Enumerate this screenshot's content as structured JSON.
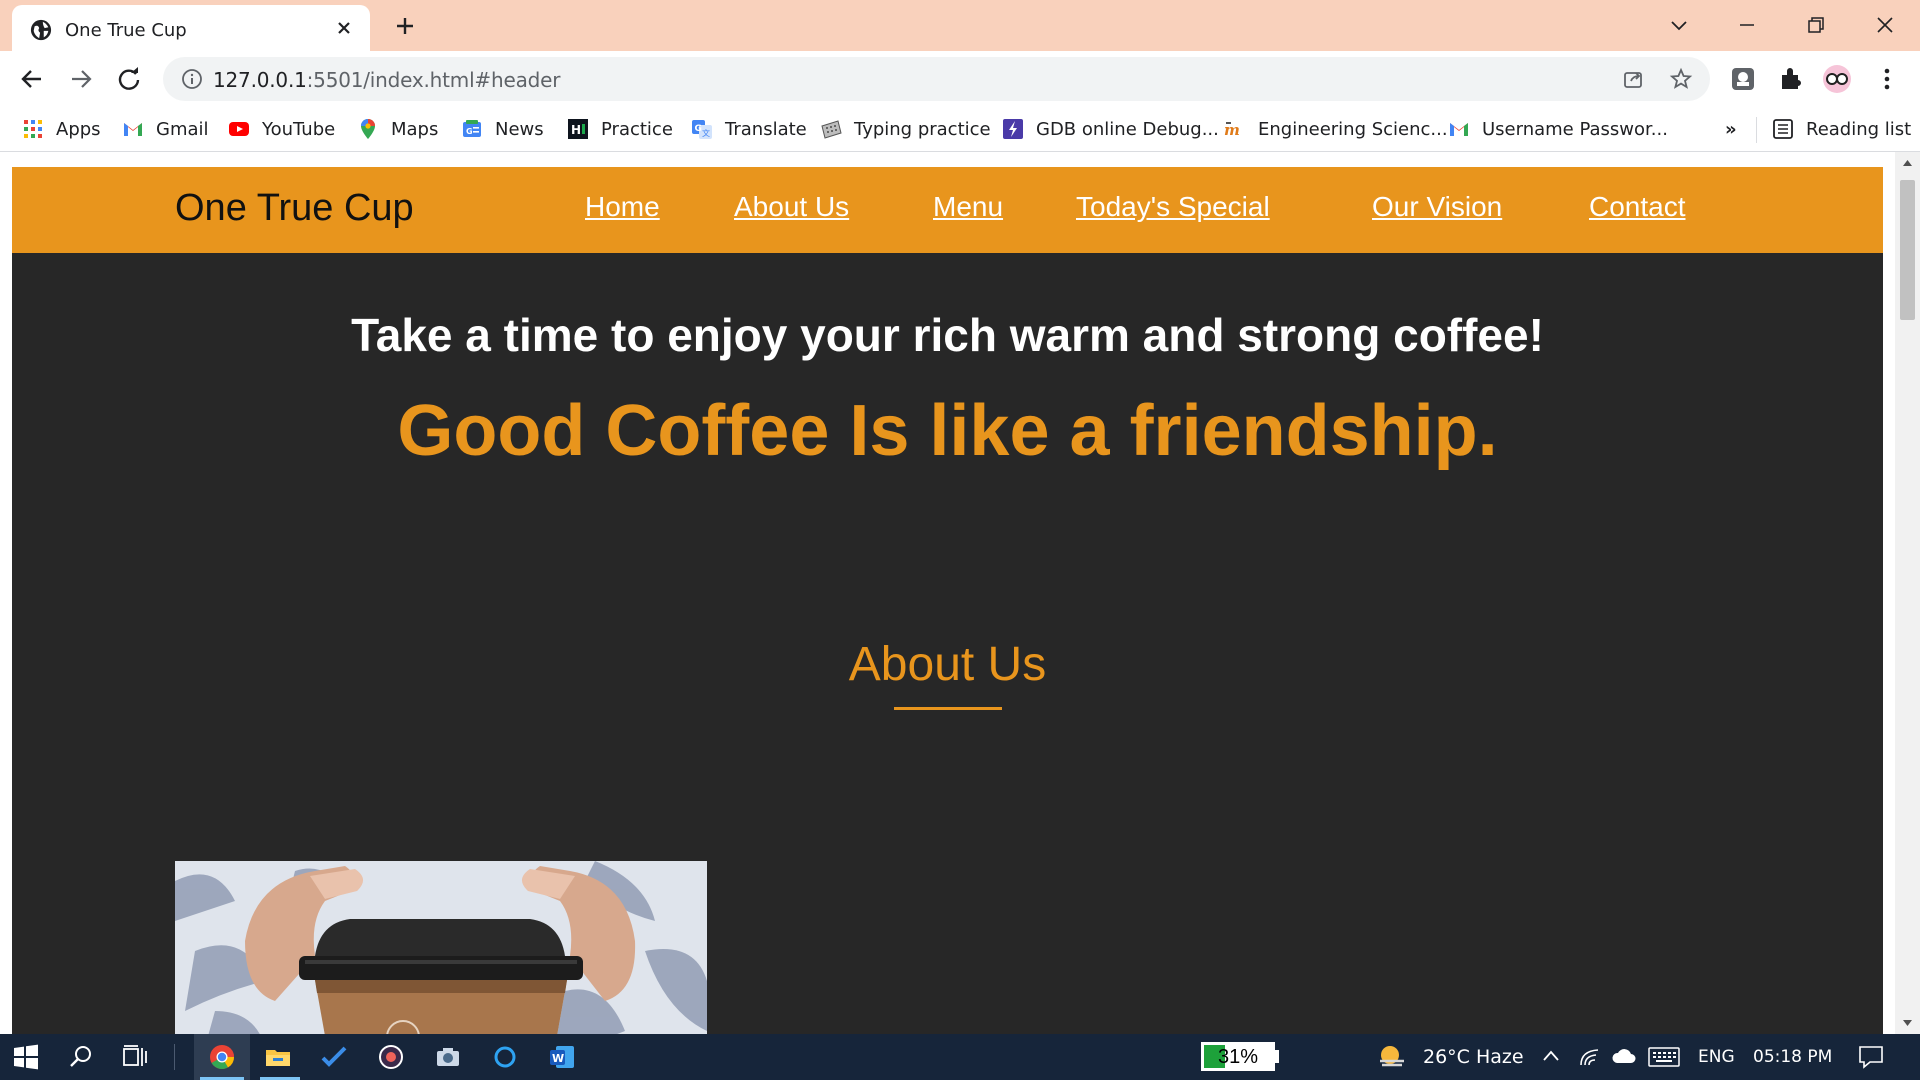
{
  "browser": {
    "tab_title": "One True Cup",
    "url_host": "127.0.0.1",
    "url_rest": ":5501/index.html#header",
    "bookmarks": [
      {
        "label": "Apps",
        "icon": "apps-grid-icon"
      },
      {
        "label": "Gmail",
        "icon": "gmail-icon"
      },
      {
        "label": "YouTube",
        "icon": "youtube-icon"
      },
      {
        "label": "Maps",
        "icon": "maps-pin-icon"
      },
      {
        "label": "News",
        "icon": "news-icon"
      },
      {
        "label": "Practice",
        "icon": "hackerrank-icon"
      },
      {
        "label": "Translate",
        "icon": "translate-icon"
      },
      {
        "label": "Typing practice",
        "icon": "typing-icon"
      },
      {
        "label": "GDB online Debug...",
        "icon": "gdb-icon"
      },
      {
        "label": "Engineering Scienc...",
        "icon": "engineering-icon"
      },
      {
        "label": "Username Passwor...",
        "icon": "gmail-icon"
      }
    ],
    "overflow_label": "»",
    "reading_list_label": "Reading list"
  },
  "site": {
    "brand": "One True Cup",
    "nav": [
      {
        "label": "Home"
      },
      {
        "label": "About Us"
      },
      {
        "label": "Menu"
      },
      {
        "label": "Today's Special"
      },
      {
        "label": "Our Vision"
      },
      {
        "label": "Contact"
      }
    ],
    "hero_line1": "Take a time to enjoy your rich warm and strong coffee!",
    "hero_line2": "Good Coffee Is like a friendship.",
    "about_title": "About Us"
  },
  "taskbar": {
    "battery_percent": 31,
    "battery_label": "31%",
    "weather": "26°C  Haze",
    "language": "ENG",
    "time": "05:18 PM"
  },
  "colors": {
    "accent": "#e8951d",
    "page_bg": "#272727",
    "tab_strip": "#f9d1bc",
    "taskbar": "#16253a"
  }
}
